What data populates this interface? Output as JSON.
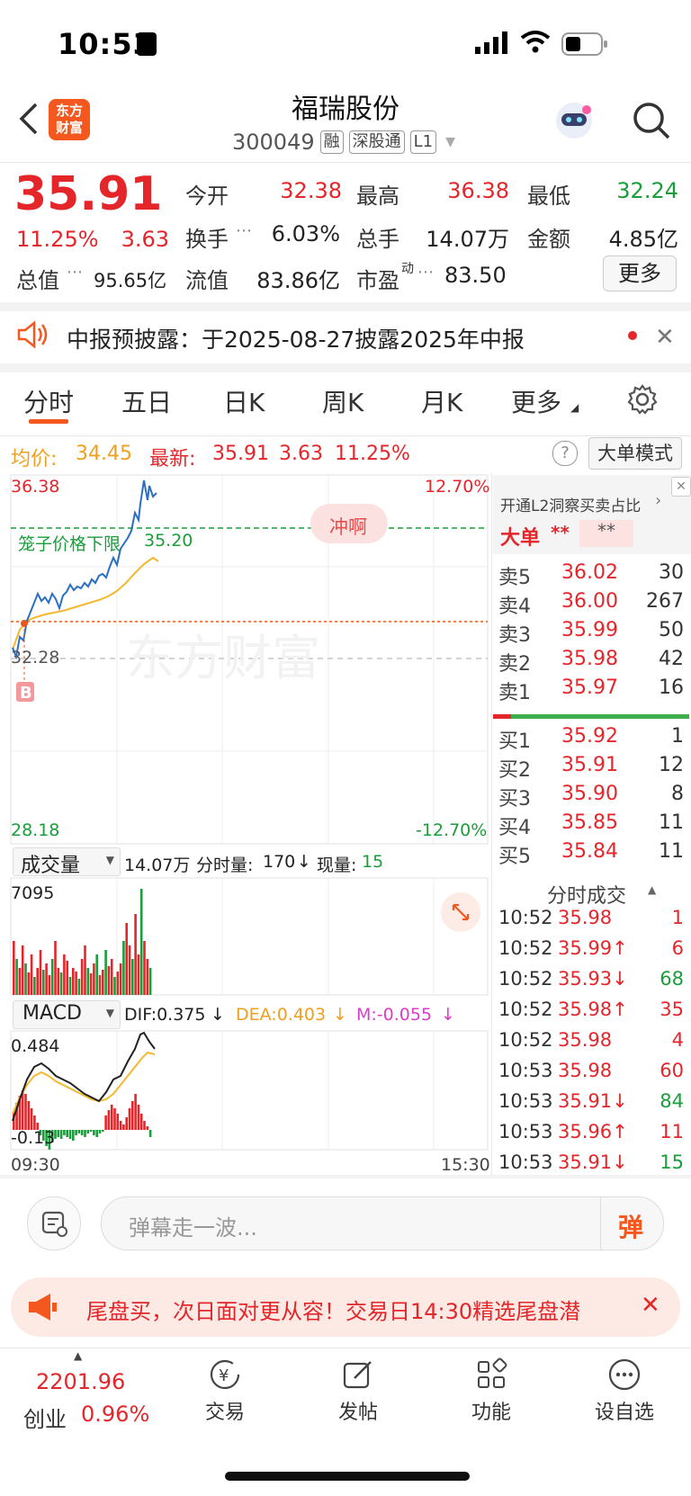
{
  "status_bar": {
    "time": "10:53"
  },
  "header": {
    "logo_text": "东方财富",
    "stock_name": "福瑞股份",
    "stock_code": "300049",
    "tags": [
      "融",
      "深股通",
      "L1"
    ]
  },
  "quote": {
    "price": "35.91",
    "change_pct": "11.25%",
    "change": "3.63",
    "open_label": "今开",
    "open": "32.38",
    "high_label": "最高",
    "high": "36.38",
    "low_label": "最低",
    "low": "32.24",
    "turnover_rate_label": "换手",
    "turnover_rate": "6.03%",
    "volume_label": "总手",
    "volume": "14.07万",
    "amount_label": "金额",
    "amount": "4.85亿",
    "market_cap_label": "总值",
    "market_cap": "95.65亿",
    "float_cap_label": "流值",
    "float_cap": "83.86亿",
    "pe_label": "市盈",
    "pe_sup": "动",
    "pe": "83.50",
    "more_label": "更多"
  },
  "notice": {
    "text": "中报预披露：于2025-08-27披露2025年中报"
  },
  "tabs": [
    "分时",
    "五日",
    "日K",
    "周K",
    "月K",
    "更多"
  ],
  "chart_info": {
    "avg_label": "均价:",
    "avg": "34.45",
    "latest_label": "最新:",
    "latest": "35.91",
    "latest_change": "3.63",
    "latest_pct": "11.25%",
    "mode_button": "大单模式"
  },
  "chart_labels": {
    "y_top": "36.38",
    "y_mid": "32.28",
    "y_bottom": "28.18",
    "pct_top": "12.70%",
    "pct_bottom": "-12.70%",
    "cage_label": "笼子价格下限",
    "cage_value": "35.20",
    "rush_badge": "冲啊",
    "watermark": "东方财富",
    "buy_marker": "B"
  },
  "volume_panel": {
    "selector": "成交量",
    "total": "14.07万",
    "minute_label": "分时量:",
    "minute_value": "170",
    "current_label": "现量:",
    "current_value": "15",
    "y_max": "7095"
  },
  "macd_panel": {
    "selector": "MACD",
    "dif": "DIF:0.375",
    "dea": "DEA:0.403",
    "m": "M:-0.055",
    "y_top": "0.484",
    "y_bottom": "-0.13",
    "time_start": "09:30",
    "time_end": "15:30"
  },
  "order_book": {
    "promo": "开通L2洞察买卖占比",
    "big_order_label": "大单",
    "big_order_red": "**",
    "big_order_gray": "**",
    "asks": [
      {
        "label": "卖5",
        "price": "36.02",
        "vol": "30"
      },
      {
        "label": "卖4",
        "price": "36.00",
        "vol": "267"
      },
      {
        "label": "卖3",
        "price": "35.99",
        "vol": "50"
      },
      {
        "label": "卖2",
        "price": "35.98",
        "vol": "42"
      },
      {
        "label": "卖1",
        "price": "35.97",
        "vol": "16"
      }
    ],
    "bids": [
      {
        "label": "买1",
        "price": "35.92",
        "vol": "1"
      },
      {
        "label": "买2",
        "price": "35.91",
        "vol": "12"
      },
      {
        "label": "买3",
        "price": "35.90",
        "vol": "8"
      },
      {
        "label": "买4",
        "price": "35.85",
        "vol": "11"
      },
      {
        "label": "买5",
        "price": "35.84",
        "vol": "11"
      }
    ],
    "ticks_title": "分时成交",
    "ticks": [
      {
        "time": "10:52",
        "price": "35.98",
        "arrow": "",
        "vol": "1",
        "dir": "up"
      },
      {
        "time": "10:52",
        "price": "35.99↑",
        "arrow": "",
        "vol": "6",
        "dir": "up"
      },
      {
        "time": "10:52",
        "price": "35.93↓",
        "arrow": "",
        "vol": "68",
        "dir": "down"
      },
      {
        "time": "10:52",
        "price": "35.98↑",
        "arrow": "",
        "vol": "35",
        "dir": "up"
      },
      {
        "time": "10:52",
        "price": "35.98",
        "arrow": "",
        "vol": "4",
        "dir": "up"
      },
      {
        "time": "10:53",
        "price": "35.98",
        "arrow": "",
        "vol": "60",
        "dir": "up"
      },
      {
        "time": "10:53",
        "price": "35.91↓",
        "arrow": "",
        "vol": "84",
        "dir": "down"
      },
      {
        "time": "10:53",
        "price": "35.96↑",
        "arrow": "",
        "vol": "11",
        "dir": "up"
      },
      {
        "time": "10:53",
        "price": "35.91↓",
        "arrow": "",
        "vol": "15",
        "dir": "down"
      }
    ]
  },
  "comment": {
    "placeholder": "弹幕走一波...",
    "send_icon_text": "弹"
  },
  "banner": {
    "text": "尾盘买，次日面对更从容！交易日14:30精选尾盘潜"
  },
  "bottom_nav": {
    "index_value": "2201.96",
    "index_name": "创业",
    "index_pct": "0.96%",
    "items": [
      "交易",
      "发帖",
      "功能",
      "设自选"
    ]
  },
  "colors": {
    "up": "#e4262b",
    "down": "#1a9d3a",
    "accent": "#f4581e",
    "price_line": "#2a6fc4",
    "avg_line": "#f5b82e"
  }
}
